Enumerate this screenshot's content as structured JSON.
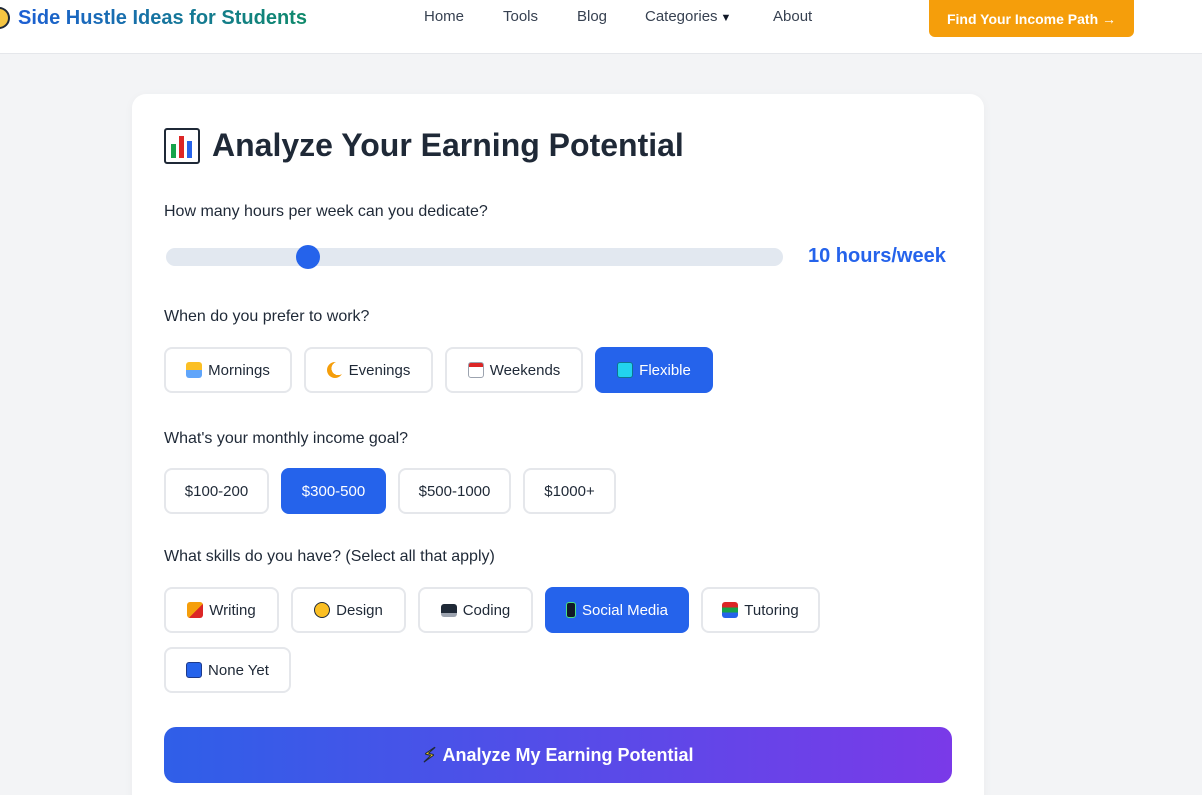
{
  "header": {
    "brand": "Side Hustle Ideas for Students",
    "nav": [
      {
        "label": "Home"
      },
      {
        "label": "Tools"
      },
      {
        "label": "Blog"
      },
      {
        "label": "Categories"
      },
      {
        "label": "About"
      }
    ],
    "cta_label": "Find Your Income Path →"
  },
  "form": {
    "title": "Analyze Your Earning Potential",
    "hours": {
      "question": "How many hours per week can you dedicate?",
      "value_label": "10 hours/week",
      "value_fraction": 0.22
    },
    "time": {
      "question": "When do you prefer to work?",
      "options": [
        {
          "label": "Mornings",
          "icon": "sunrise-icon"
        },
        {
          "label": "Evenings",
          "icon": "moon-icon"
        },
        {
          "label": "Weekends",
          "icon": "calendar-icon"
        },
        {
          "label": "Flexible",
          "icon": "repeat-icon"
        }
      ],
      "selected": "Flexible"
    },
    "income": {
      "question": "What's your monthly income goal?",
      "options": [
        {
          "label": "$100-200"
        },
        {
          "label": "$300-500"
        },
        {
          "label": "$500-1000"
        },
        {
          "label": "$1000+"
        }
      ],
      "selected": "$300-500"
    },
    "skills": {
      "question": "What skills do you have? (Select all that apply)",
      "options": [
        {
          "label": "Writing",
          "icon": "writing-hand-icon"
        },
        {
          "label": "Design",
          "icon": "palette-icon"
        },
        {
          "label": "Coding",
          "icon": "laptop-icon"
        },
        {
          "label": "Social Media",
          "icon": "phone-icon"
        },
        {
          "label": "Tutoring",
          "icon": "books-icon"
        },
        {
          "label": "None Yet",
          "icon": "new-icon"
        }
      ],
      "selected": [
        "Social Media"
      ]
    },
    "submit_label": "Analyze My Earning Potential"
  },
  "colors": {
    "accent": "#2563eb",
    "cta": "#f59e0b",
    "gradient_start": "#2f5fe8",
    "gradient_end": "#7a3ae8"
  }
}
